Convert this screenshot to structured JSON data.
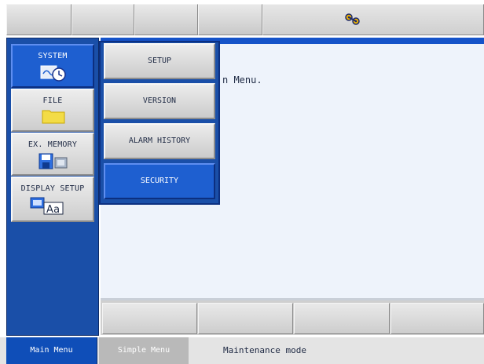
{
  "top_toolbar": {
    "status_icon": "robot-link-icon",
    "accent_color": "#f0b400"
  },
  "sidebar": {
    "items": [
      {
        "label": "SYSTEM",
        "icon": "system-clock-icon",
        "active": true
      },
      {
        "label": "FILE",
        "icon": "folder-icon",
        "active": false
      },
      {
        "label": "EX. MEMORY",
        "icon": "floppy-disk-icon",
        "active": false
      },
      {
        "label": "DISPLAY SETUP",
        "icon": "display-font-icon",
        "active": false
      }
    ]
  },
  "submenu": {
    "items": [
      {
        "label": "SETUP"
      },
      {
        "label": "VERSION"
      },
      {
        "label": "ALARM HISTORY"
      },
      {
        "label": "SECURITY",
        "selected": true
      }
    ]
  },
  "main": {
    "text": "n Menu."
  },
  "footer": {
    "main_menu": "Main Menu",
    "simple_menu": "Simple Menu",
    "status": "Maintenance mode"
  },
  "colors": {
    "panel_blue": "#1a4fa8",
    "selected_blue": "#1e5fd0",
    "content_bg": "#eef3fb"
  }
}
